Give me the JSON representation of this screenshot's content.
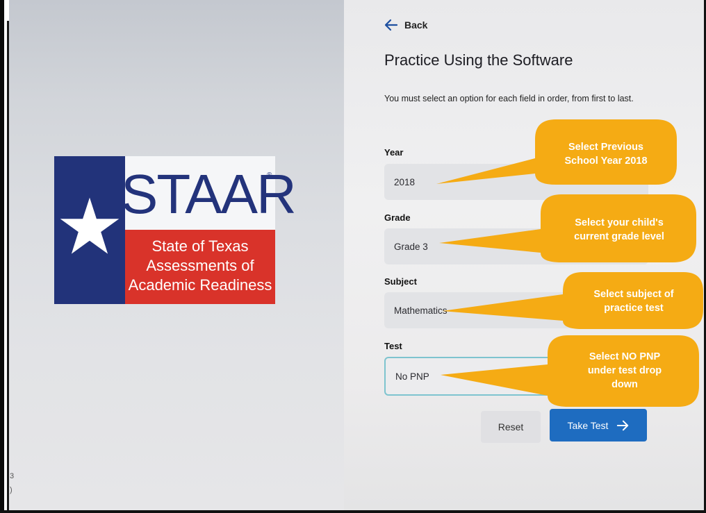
{
  "logo": {
    "word": "STAAR",
    "registered": "®",
    "subtitle_lines": [
      "State of Texas",
      "Assessments of",
      "Academic Readiness"
    ],
    "colors": {
      "blue": "#22337a",
      "red": "#d9332a",
      "white": "#f5f6f8"
    }
  },
  "side_marks": [
    "3",
    ")"
  ],
  "header": {
    "back_label": "Back",
    "title": "Practice Using the Software",
    "instructions": "You must select an option for each field in order, from first to last."
  },
  "form": {
    "fields": [
      {
        "label": "Year",
        "value": "2018"
      },
      {
        "label": "Grade",
        "value": "Grade 3"
      },
      {
        "label": "Subject",
        "value": "Mathematics"
      },
      {
        "label": "Test",
        "value": "No PNP"
      }
    ],
    "reset_label": "Reset",
    "take_test_label": "Take Test"
  },
  "callouts": [
    {
      "lines": [
        "Select Previous",
        "School Year 2018"
      ]
    },
    {
      "lines": [
        "Select  your child's",
        "current grade level"
      ]
    },
    {
      "lines": [
        "Select  subject of",
        "practice test"
      ]
    },
    {
      "lines": [
        "Select NO PNP",
        "under test drop",
        "down"
      ]
    }
  ],
  "colors": {
    "callout": "#f5ab14",
    "accent": "#1e6cc0",
    "active_border": "#7ec4cf"
  }
}
